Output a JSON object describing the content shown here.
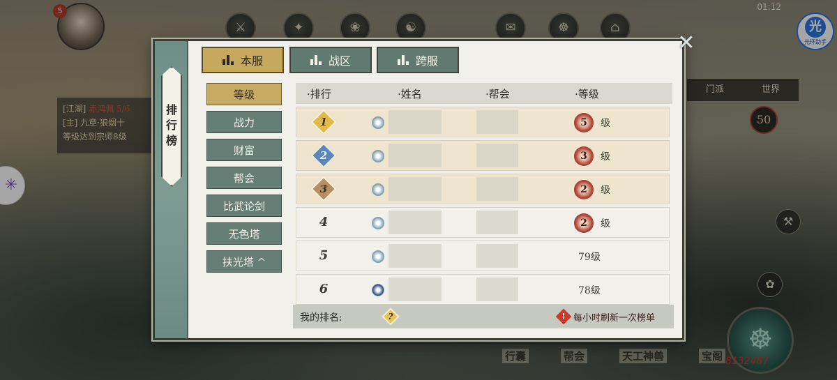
{
  "status_bar": {
    "time": "01:12"
  },
  "avatar": {
    "level": "5"
  },
  "helper_badge": {
    "big": "光",
    "small": "光环助手"
  },
  "left_quest": {
    "line1_tag": "[江湖]",
    "line1_text": "赤鸿佩 5/6",
    "line2": "[主] 九章·狼烟十",
    "line3": "等级达到宗师8级"
  },
  "right_panel": {
    "tabs": [
      "门派",
      "世界"
    ],
    "level": "50",
    "power": "8132487"
  },
  "bottom_nav": [
    "行囊",
    "帮会",
    "天工神兽",
    "宝阁"
  ],
  "leaderboard": {
    "rail_title": "排行榜",
    "close_glyph": "✕",
    "tabs": [
      {
        "label": "本服",
        "active": true
      },
      {
        "label": "战区",
        "active": false
      },
      {
        "label": "跨服",
        "active": false
      }
    ],
    "categories": [
      {
        "label": "等级",
        "active": true
      },
      {
        "label": "战力",
        "active": false
      },
      {
        "label": "财富",
        "active": false
      },
      {
        "label": "帮会",
        "active": false
      },
      {
        "label": "比武论剑",
        "active": false
      },
      {
        "label": "无色塔",
        "active": false
      },
      {
        "label": "扶光塔 ^",
        "active": false
      }
    ],
    "columns": [
      "排行",
      "姓名",
      "帮会",
      "等级"
    ],
    "rows": [
      {
        "rank": "1",
        "level_badge": "5",
        "level_suffix": "级",
        "level_text": "",
        "highlight": true,
        "rank_color": "#e3b94a"
      },
      {
        "rank": "2",
        "level_badge": "3",
        "level_suffix": "级",
        "level_text": "",
        "highlight": true,
        "rank_color": "#5b86b8"
      },
      {
        "rank": "3",
        "level_badge": "2",
        "level_suffix": "级",
        "level_text": "",
        "highlight": true,
        "rank_color": "#b88e63"
      },
      {
        "rank": "4",
        "level_badge": "2",
        "level_suffix": "级",
        "level_text": "",
        "highlight": false,
        "rank_color": ""
      },
      {
        "rank": "5",
        "level_badge": "",
        "level_suffix": "",
        "level_text": "79级",
        "highlight": false,
        "rank_color": ""
      },
      {
        "rank": "6",
        "level_badge": "",
        "level_suffix": "",
        "level_text": "78级",
        "highlight": false,
        "rank_color": ""
      }
    ],
    "my_rank": {
      "label": "我的排名:",
      "rank": "?"
    },
    "refresh_note": "每小时刷新一次榜单",
    "refresh_mark": "!"
  }
}
